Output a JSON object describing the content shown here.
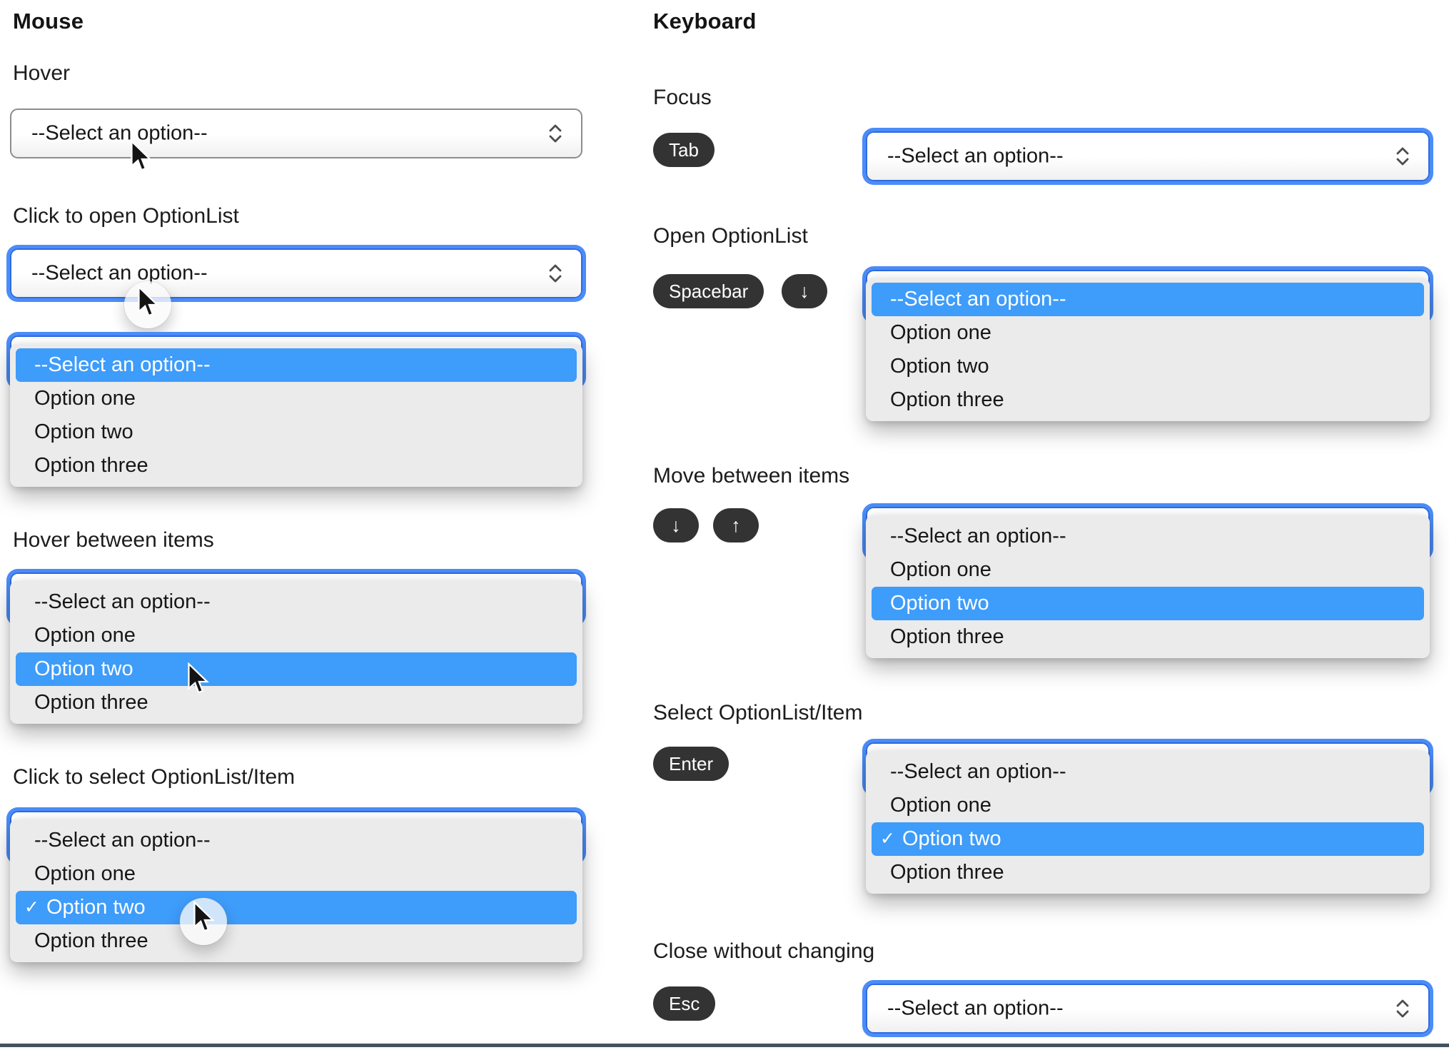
{
  "select": {
    "placeholder": "--Select an option--",
    "options": [
      "--Select an option--",
      "Option one",
      "Option two",
      "Option three"
    ],
    "checkmark": "✓"
  },
  "mouse": {
    "title": "Mouse",
    "hover_label": "Hover",
    "click_open_label": "Click to open OptionList",
    "hover_items_label": "Hover between items",
    "click_select_label": "Click to select OptionList/Item"
  },
  "keyboard": {
    "title": "Keyboard",
    "focus_label": "Focus",
    "open_label": "Open OptionList",
    "move_label": "Move between items",
    "select_label": "Select OptionList/Item",
    "close_label": "Close without changing",
    "keys": {
      "tab": "Tab",
      "spacebar": "Spacebar",
      "down": "↓",
      "up": "↑",
      "enter": "Enter",
      "esc": "Esc"
    }
  },
  "colors": {
    "highlight": "#3E9CFA",
    "focus_ring": "#4B8CF8",
    "focus_ring_border": "#2D6BE0",
    "key_bg": "#333333",
    "list_bg": "#EBEBEB",
    "bottom_rule": "#44525C"
  }
}
